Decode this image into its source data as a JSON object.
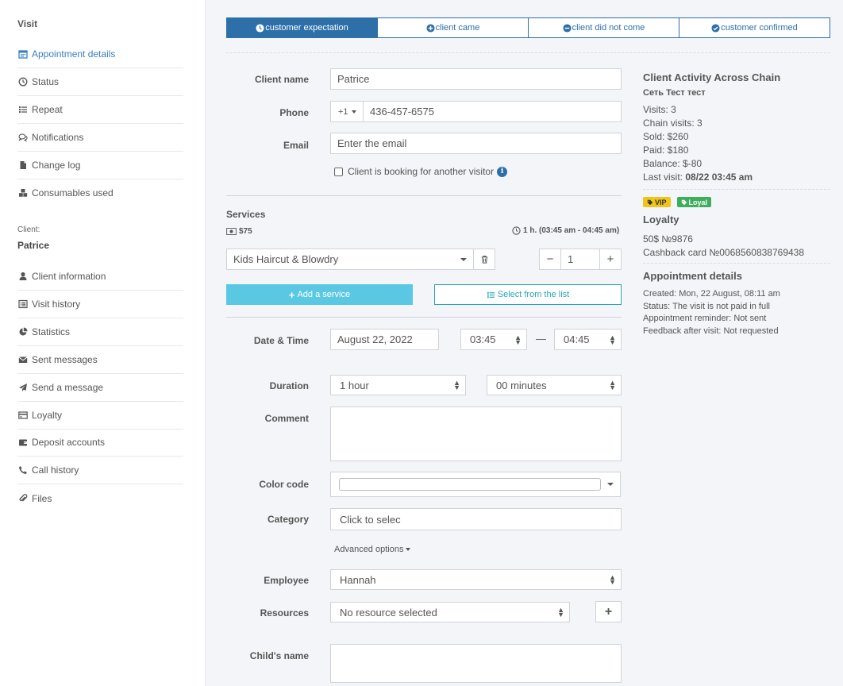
{
  "sidebar": {
    "visit_title": "Visit",
    "visit_items": [
      {
        "label": "Appointment details",
        "icon": "calendar-icon"
      },
      {
        "label": "Status",
        "icon": "clock-icon"
      },
      {
        "label": "Repeat",
        "icon": "list-icon"
      },
      {
        "label": "Notifications",
        "icon": "comments-icon"
      },
      {
        "label": "Change log",
        "icon": "file-icon"
      },
      {
        "label": "Consumables used",
        "icon": "cubes-icon"
      }
    ],
    "client_label": "Client:",
    "client_name": "Patrice",
    "client_items": [
      {
        "label": "Client information",
        "icon": "user-icon"
      },
      {
        "label": "Visit history",
        "icon": "list-alt-icon"
      },
      {
        "label": "Statistics",
        "icon": "pie-chart-icon"
      },
      {
        "label": "Sent messages",
        "icon": "envelope-icon"
      },
      {
        "label": "Send a message",
        "icon": "paper-plane-icon"
      },
      {
        "label": "Loyalty",
        "icon": "credit-card-icon"
      },
      {
        "label": "Deposit accounts",
        "icon": "wallet-icon"
      },
      {
        "label": "Call history",
        "icon": "phone-icon"
      },
      {
        "label": "Files",
        "icon": "paperclip-icon"
      }
    ]
  },
  "status_tabs": [
    "customer expectation",
    "client came",
    "client did not come",
    "customer confirmed"
  ],
  "form": {
    "client_name_label": "Client name",
    "client_name_value": "Patrice",
    "phone_label": "Phone",
    "phone_code": "+1",
    "phone_value": "436-457-6575",
    "email_label": "Email",
    "email_placeholder": "Enter the email",
    "another_visitor": "Client is booking for another visitor",
    "services_title": "Services",
    "services_price": "$75",
    "services_time": "1 h. (03:45 am - 04:45 am)",
    "service_name": "Kids Haircut & Blowdry",
    "service_qty": "1",
    "add_service": "Add a service",
    "select_list": "Select from the list",
    "datetime_label": "Date & Time",
    "date_value": "August 22, 2022",
    "time_start": "03:45",
    "time_dash": "—",
    "time_end": "04:45",
    "duration_label": "Duration",
    "duration_hours": "1 hour",
    "duration_minutes": "00 minutes",
    "comment_label": "Comment",
    "color_label": "Color code",
    "category_label": "Category",
    "category_placeholder": "Click to selec",
    "advanced": "Advanced options",
    "employee_label": "Employee",
    "employee_value": "Hannah",
    "resources_label": "Resources",
    "resources_value": "No resource selected",
    "child_label": "Child's name"
  },
  "activity": {
    "title": "Client Activity Across Chain",
    "chain": "Сеть Тест тест",
    "visits": "Visits: 3",
    "chain_visits": "Chain visits: 3",
    "sold": "Sold: $260",
    "paid": "Paid: $180",
    "balance": "Balance: $-80",
    "last_visit_label": "Last visit: ",
    "last_visit_value": "08/22 03:45 am",
    "badges": [
      {
        "label": "VIP",
        "color": "#f0c419",
        "text_color": "#333"
      },
      {
        "label": "Loyal",
        "color": "#3fae5c",
        "text_color": "#fff"
      }
    ]
  },
  "loyalty": {
    "title": "Loyalty",
    "card1": "50$ №9876",
    "card2": "Cashback card №0068560838769438"
  },
  "appointment_details": {
    "title": "Appointment details",
    "created": "Created: Mon, 22 August, 08:11 am",
    "status": "Status: The visit is not paid in full",
    "reminder": "Appointment reminder: Not sent",
    "feedback": "Feedback after visit: Not requested"
  },
  "colors": {
    "primary": "#2d6fa8",
    "accent": "#5bc8e3",
    "link": "#3a7fc1"
  }
}
